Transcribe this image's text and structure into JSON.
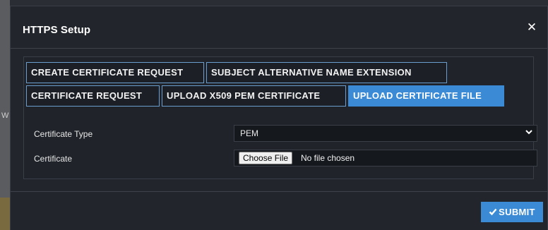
{
  "dialog": {
    "title": "HTTPS Setup",
    "close_icon": "close-icon"
  },
  "tabs": [
    {
      "label": "CREATE CERTIFICATE REQUEST",
      "active": false
    },
    {
      "label": "SUBJECT ALTERNATIVE NAME EXTENSION",
      "active": false
    },
    {
      "label": "CERTIFICATE REQUEST",
      "active": false
    },
    {
      "label": "UPLOAD X509 PEM CERTIFICATE",
      "active": false
    },
    {
      "label": "UPLOAD CERTIFICATE FILE",
      "active": true
    }
  ],
  "form": {
    "certificate_type": {
      "label": "Certificate Type",
      "value": "PEM",
      "icon": "chevron-down-icon"
    },
    "certificate": {
      "label": "Certificate",
      "button_label": "Choose File",
      "status": "No file chosen"
    }
  },
  "footer": {
    "submit_label": "SUBMIT",
    "submit_icon": "check-icon"
  },
  "background": {
    "partial_text": "W"
  },
  "colors": {
    "accent": "#3a8ad6",
    "tab_border": "#6a9ecf",
    "dialog_bg": "#22262c"
  }
}
